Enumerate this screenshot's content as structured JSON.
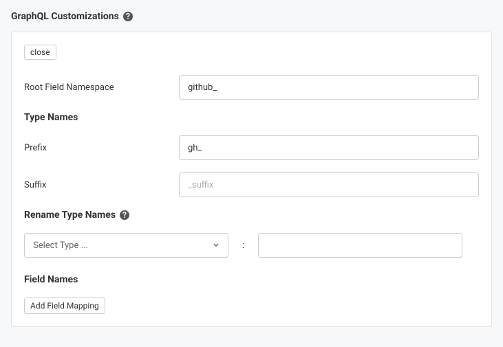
{
  "section": {
    "title": "GraphQL Customizations"
  },
  "panel": {
    "close_label": "close",
    "root_field": {
      "label": "Root Field Namespace",
      "value": "github_"
    },
    "type_names": {
      "heading": "Type Names",
      "prefix": {
        "label": "Prefix",
        "value": "gh_"
      },
      "suffix": {
        "label": "Suffix",
        "placeholder": "_suffix",
        "value": ""
      }
    },
    "rename": {
      "heading": "Rename Type Names",
      "select_placeholder": "Select Type ...",
      "colon": ":",
      "target_value": ""
    },
    "field_names": {
      "heading": "Field Names",
      "add_button_label": "Add Field Mapping"
    }
  }
}
